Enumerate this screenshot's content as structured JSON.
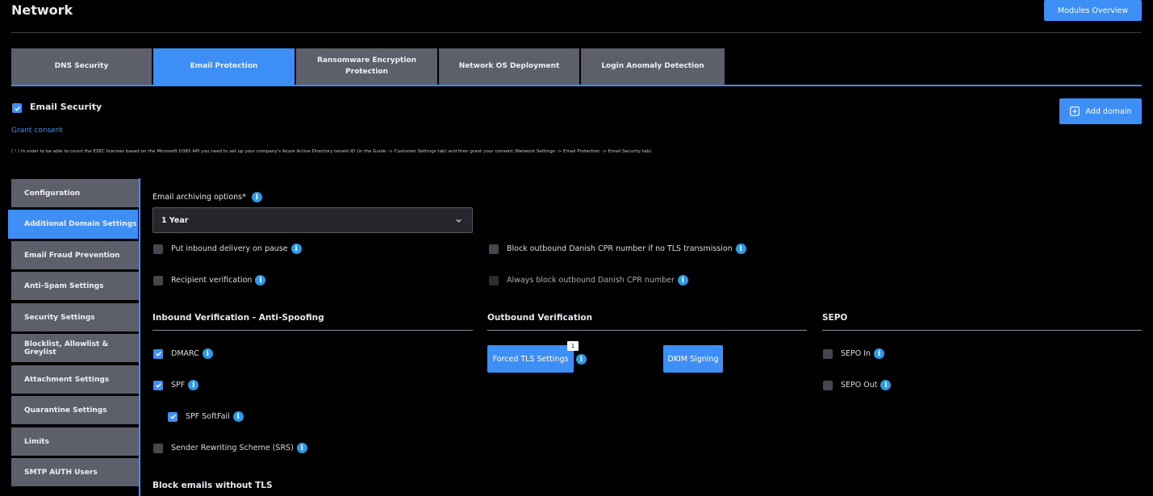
{
  "header": {
    "title": "Network",
    "modules_overview": "Modules Overview"
  },
  "tabs": [
    {
      "label": "DNS Security",
      "active": false
    },
    {
      "label": "Email Protection",
      "active": true
    },
    {
      "label": "Ransomware Encryption Protection",
      "active": false
    },
    {
      "label": "Network OS Deployment",
      "active": false
    },
    {
      "label": "Login Anomaly Detection",
      "active": false
    }
  ],
  "email_security": {
    "label": "Email Security",
    "checked": true,
    "grant_consent": "Grant consent",
    "notice": "( ! ) In order to be able to count the ESEC licenses based on the Microsoft O365 API you need to set up your company's Azure Active Directory tenant ID (in the Guide -> Customer Settings tab) and then grant your consent (Network Settings -> Email Protection -> Email Security tab)",
    "add_domain": "Add domain"
  },
  "side_menu": [
    {
      "label": "Configuration",
      "active": false
    },
    {
      "label": "Additional Domain Settings",
      "active": true
    },
    {
      "label": "Email Fraud Prevention",
      "active": false
    },
    {
      "label": "Anti-Spam Settings",
      "active": false
    },
    {
      "label": "Security Settings",
      "active": false
    },
    {
      "label": "Blocklist, Allowlist & Greylist",
      "active": false
    },
    {
      "label": "Attachment Settings",
      "active": false
    },
    {
      "label": "Quarantine Settings",
      "active": false
    },
    {
      "label": "Limits",
      "active": false
    },
    {
      "label": "SMTP AUTH Users",
      "active": false
    }
  ],
  "archiving": {
    "label": "Email archiving options*",
    "value": "1 Year"
  },
  "options": {
    "inbound_pause": {
      "label": "Put inbound delivery on pause",
      "checked": false
    },
    "recipient_verification": {
      "label": "Recipient verification",
      "checked": false
    },
    "block_cpr_no_tls": {
      "label": "Block outbound Danish CPR number if no TLS transmission",
      "checked": false
    },
    "always_block_cpr": {
      "label": "Always block outbound Danish CPR number",
      "checked": false,
      "disabled": true
    }
  },
  "inbound": {
    "title": "Inbound Verification - Anti-Spoofing",
    "dmarc": {
      "label": "DMARC",
      "checked": true
    },
    "spf": {
      "label": "SPF",
      "checked": true
    },
    "spf_softfail": {
      "label": "SPF SoftFail",
      "checked": true
    },
    "srs": {
      "label": "Sender Rewriting Scheme (SRS)",
      "checked": false
    }
  },
  "outbound": {
    "title": "Outbound Verification",
    "forced_tls": "Forced TLS Settings",
    "forced_tls_badge": "1",
    "dkim": "DKIM Signing"
  },
  "sepo": {
    "title": "SEPO",
    "sepo_in": {
      "label": "SEPO In",
      "checked": false
    },
    "sepo_out": {
      "label": "SEPO Out",
      "checked": false
    }
  },
  "block_tls": {
    "title": "Block emails without TLS"
  },
  "info_glyph": "i",
  "colors": {
    "accent": "#3d8ef5",
    "tab_inactive": "#5d5f6b",
    "info": "#2b9be6",
    "background": "#000000"
  }
}
